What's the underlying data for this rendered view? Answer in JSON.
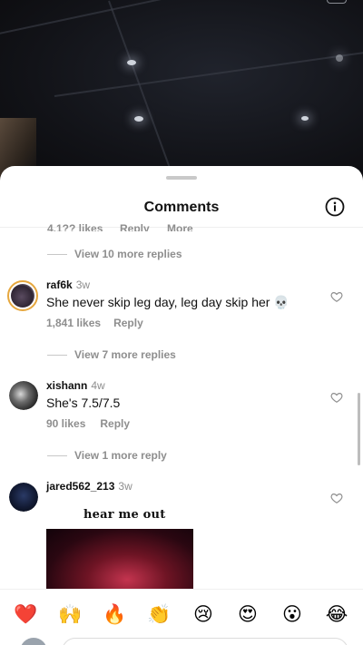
{
  "header": {
    "title": "Comments",
    "info_icon": "info-circle-icon"
  },
  "partial_row": {
    "likes": "4,1?? likes",
    "reply": "Reply",
    "more": "More"
  },
  "threads": [
    {
      "view_replies": "View 10 more replies"
    },
    {
      "username": "raf6k",
      "time": "3w",
      "text": "She never skip leg day, leg day skip her 💀",
      "likes": "1,841 likes",
      "reply": "Reply",
      "view_replies": "View 7 more replies"
    },
    {
      "username": "xishann",
      "time": "4w",
      "text": "She's 7.5/7.5",
      "likes": "90 likes",
      "reply": "Reply",
      "view_replies": "View 1 more reply"
    },
    {
      "username": "jared562_213",
      "time": "3w",
      "gif_caption": "hear me out"
    }
  ],
  "emoji_bar": [
    "❤️",
    "🙌",
    "🔥",
    "👏",
    "😢",
    "😍",
    "😮",
    "😂"
  ],
  "colors": {
    "ring": "#e6a73e",
    "text": "#111111",
    "muted": "#8e8e8e"
  }
}
